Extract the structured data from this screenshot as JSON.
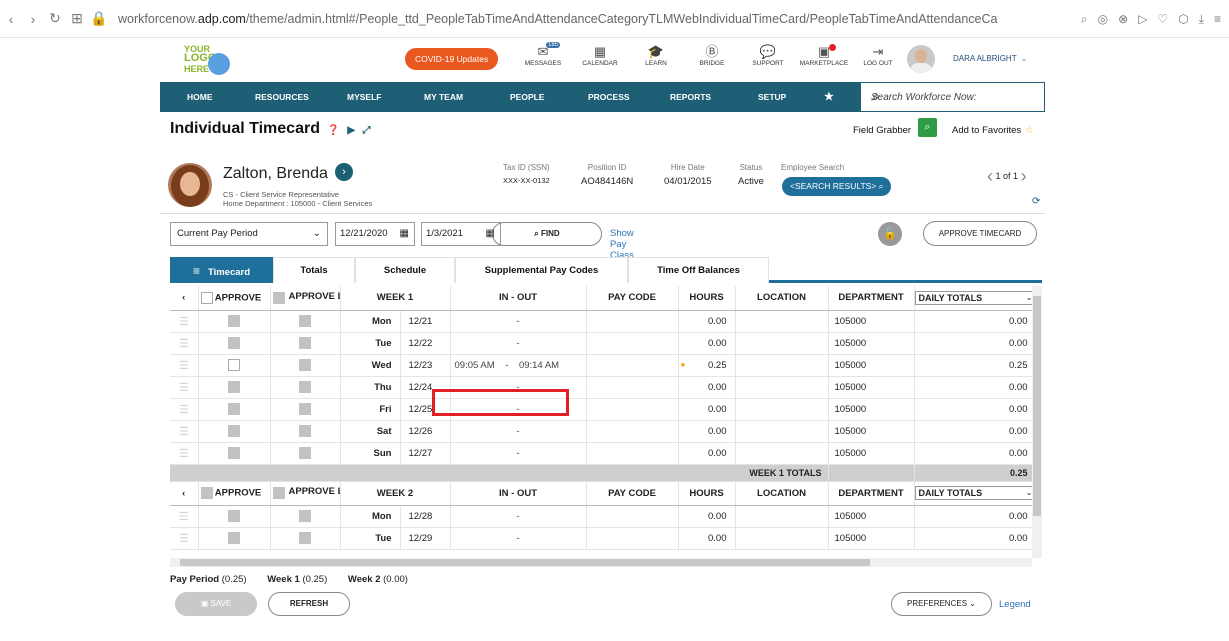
{
  "browser": {
    "url_prefix": "workforcenow.",
    "url_domain": "adp.com",
    "url_rest": "/theme/admin.html#/People_ttd_PeopleTabTimeAndAttendanceCategoryTLMWebIndividualTimeCard/PeopleTabTimeAndAttendanceCategoryTLMWe"
  },
  "header": {
    "logo_line1": "YOUR",
    "logo_line2": "LOGO",
    "logo_line3": "HERE",
    "covid_label": "COVID-19 Updates",
    "icons": [
      {
        "label": "MESSAGES",
        "icon": "envelope-icon",
        "badge": "185"
      },
      {
        "label": "CALENDAR",
        "icon": "calendar-icon"
      },
      {
        "label": "LEARN",
        "icon": "graduation-cap-icon"
      },
      {
        "label": "BRIDGE",
        "icon": "bridge-icon"
      },
      {
        "label": "SUPPORT",
        "icon": "chat-bubble-icon"
      },
      {
        "label": "MARKETPLACE",
        "icon": "marketplace-icon"
      },
      {
        "label": "LOG OUT",
        "icon": "logout-icon"
      }
    ],
    "user_name": "DARA ALBRIGHT"
  },
  "nav": {
    "items": [
      "HOME",
      "RESOURCES",
      "MYSELF",
      "MY TEAM",
      "PEOPLE",
      "PROCESS",
      "REPORTS",
      "SETUP",
      "★"
    ],
    "search_placeholder": "Search Workforce Now:"
  },
  "page": {
    "title": "Individual Timecard",
    "field_grabber": "Field Grabber",
    "add_favorites": "Add to Favorites"
  },
  "employee": {
    "name": "Zalton, Brenda",
    "role": "CS - Client Service Representative",
    "home_dept": "Home Department : 105000 - Client Services",
    "tax_id_label": "Tax ID (SSN)",
    "tax_id": "XXX-XX-0132",
    "position_label": "Position ID",
    "position": "AO484146N",
    "hire_label": "Hire Date",
    "hire": "04/01/2015",
    "status_label": "Status",
    "status": "Active",
    "search_label": "Employee Search",
    "search_results": "<SEARCH RESULTS>",
    "pager": "1 of 1"
  },
  "controls": {
    "period": "Current Pay Period",
    "start_date": "12/21/2020",
    "end_date": "1/3/2021",
    "find": "FIND",
    "show_pay_class": "Show Pay Class",
    "approve_timecard": "APPROVE TIMECARD"
  },
  "tabs": [
    "Timecard",
    "Totals",
    "Schedule",
    "Supplemental Pay Codes",
    "Time Off Balances"
  ],
  "grid": {
    "week1_headers": {
      "approve": "APPROVE",
      "approve_loan": "APPROVE LOAN",
      "week": "WEEK 1",
      "in_out": "IN - OUT",
      "pay_code": "PAY CODE",
      "hours": "HOURS",
      "location": "LOCATION",
      "department": "DEPARTMENT",
      "daily_totals": "DAILY TOTALS"
    },
    "week1_rows": [
      {
        "day": "Mon",
        "date": "12/21",
        "in_out": "-",
        "hours": "0.00",
        "dept": "105000",
        "total": "0.00"
      },
      {
        "day": "Tue",
        "date": "12/22",
        "in_out": "-",
        "hours": "0.00",
        "dept": "105000",
        "total": "0.00"
      },
      {
        "day": "Wed",
        "date": "12/23",
        "in_time": "09:05 AM",
        "sep": "-",
        "out_time": "09:14 AM",
        "hours": "0.25",
        "dept": "105000",
        "total": "0.25"
      },
      {
        "day": "Thu",
        "date": "12/24",
        "in_out": "-",
        "hours": "0.00",
        "dept": "105000",
        "total": "0.00"
      },
      {
        "day": "Fri",
        "date": "12/25",
        "in_out": "-",
        "hours": "0.00",
        "dept": "105000",
        "total": "0.00"
      },
      {
        "day": "Sat",
        "date": "12/26",
        "in_out": "-",
        "hours": "0.00",
        "dept": "105000",
        "total": "0.00"
      },
      {
        "day": "Sun",
        "date": "12/27",
        "in_out": "-",
        "hours": "0.00",
        "dept": "105000",
        "total": "0.00"
      }
    ],
    "week1_totals_label": "WEEK 1 TOTALS",
    "week1_totals": "0.25",
    "week2_headers": {
      "approve": "APPROVE",
      "approve_loan": "APPROVE LOAN",
      "week": "WEEK 2",
      "in_out": "IN - OUT",
      "pay_code": "PAY CODE",
      "hours": "HOURS",
      "location": "LOCATION",
      "department": "DEPARTMENT",
      "daily_totals": "DAILY TOTALS"
    },
    "week2_rows": [
      {
        "day": "Mon",
        "date": "12/28",
        "in_out": "-",
        "hours": "0.00",
        "dept": "105000",
        "total": "0.00"
      },
      {
        "day": "Tue",
        "date": "12/29",
        "in_out": "-",
        "hours": "0.00",
        "dept": "105000",
        "total": "0.00"
      }
    ]
  },
  "summary": {
    "pay_period_label": "Pay Period",
    "pay_period_value": "(0.25)",
    "week1_label": "Week 1",
    "week1_value": "(0.25)",
    "week2_label": "Week 2",
    "week2_value": "(0.00)"
  },
  "footer": {
    "save": "SAVE",
    "refresh": "REFRESH",
    "preferences": "PREFERENCES",
    "legend": "Legend"
  },
  "colors": {
    "nav_bg": "#1e5f75",
    "accent": "#1e6f9a",
    "covid": "#e9581f",
    "highlight": "#e31e24"
  }
}
